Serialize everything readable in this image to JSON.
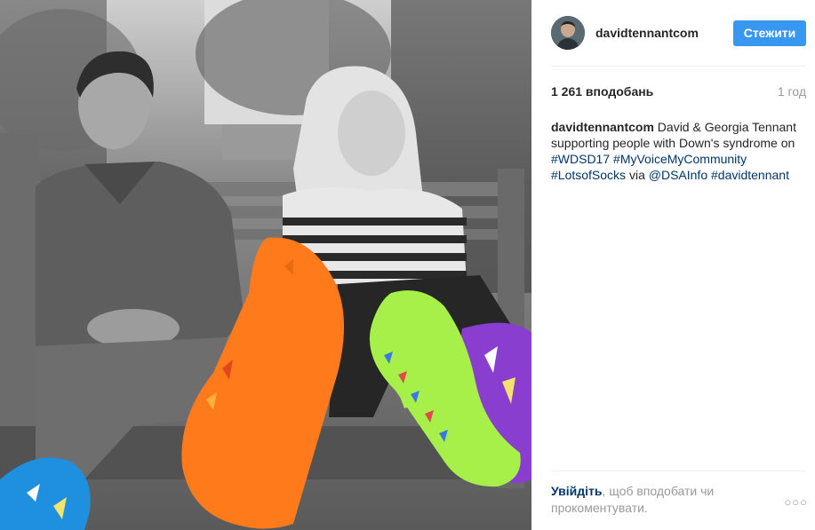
{
  "post": {
    "username": "davidtennantcom",
    "follow_label": "Стежити",
    "likes": "1 261 вподобань",
    "time_ago": "1 год",
    "caption": {
      "username": "davidtennantcom",
      "text_1": " David & Georgia Tennant supporting people with Down's syndrome on ",
      "tag_1": "#WDSD17",
      "tag_2": "#MyVoiceMyCommunity",
      "tag_3": "#LotsofSocks",
      "text_2": " via ",
      "mention": "@DSAInfo",
      "tag_4": "#davidtennant"
    },
    "login_prompt": {
      "link": "Увійдіть",
      "text": ", щоб вподобати чи прокоментувати."
    },
    "more_icon": "more-options-icon",
    "colors": {
      "follow_button": "#3897f0",
      "link": "#003569",
      "muted": "#999999",
      "orange_sock": "#ff7a1a",
      "green_sock": "#a7f04a",
      "blue_sock": "#1f8fe0",
      "purple_sock": "#8a3ed0"
    }
  }
}
